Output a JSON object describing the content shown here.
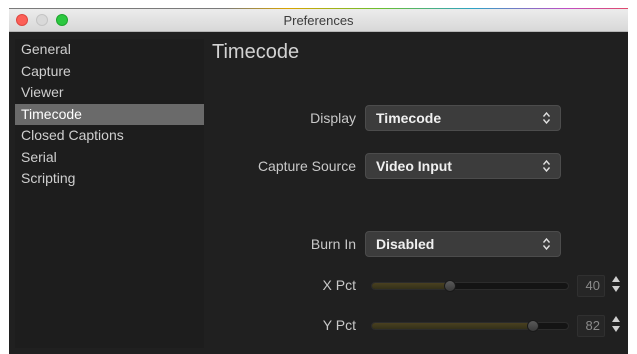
{
  "window": {
    "title": "Preferences"
  },
  "sidebar": {
    "items": [
      {
        "label": "General"
      },
      {
        "label": "Capture"
      },
      {
        "label": "Viewer"
      },
      {
        "label": "Timecode",
        "selected": true
      },
      {
        "label": "Closed Captions"
      },
      {
        "label": "Serial"
      },
      {
        "label": "Scripting"
      }
    ]
  },
  "main": {
    "title": "Timecode",
    "display": {
      "label": "Display",
      "value": "Timecode"
    },
    "capture_source": {
      "label": "Capture Source",
      "value": "Video Input"
    },
    "burn_in": {
      "label": "Burn In",
      "value": "Disabled"
    },
    "x_pct": {
      "label": "X Pct",
      "value": "40",
      "level": 0.4
    },
    "y_pct": {
      "label": "Y Pct",
      "value": "82",
      "level": 0.82
    }
  },
  "colors": {
    "background": "#202020",
    "selection": "#6a6a6a",
    "slider_fill": "#4a4020"
  },
  "icons": {
    "select_arrows": "updown-chevron-icon",
    "stepper": "stepper-arrows-icon"
  }
}
